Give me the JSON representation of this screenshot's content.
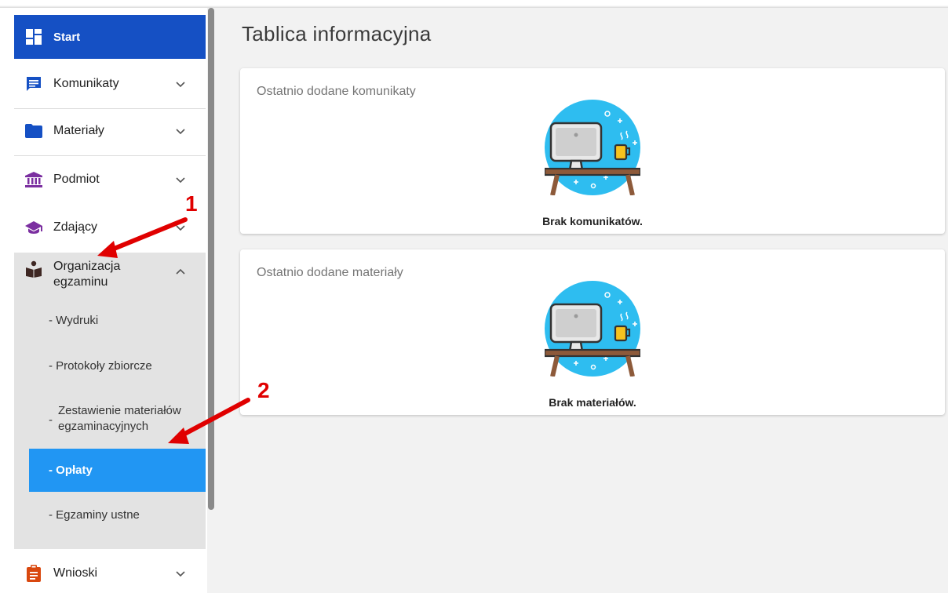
{
  "sidebar": {
    "items": [
      {
        "label": "Start",
        "icon": "dashboard-icon",
        "active": true
      },
      {
        "label": "Komunikaty",
        "icon": "message-icon"
      },
      {
        "label": "Materiały",
        "icon": "folder-icon"
      },
      {
        "label": "Podmiot",
        "icon": "institution-icon"
      },
      {
        "label": "Zdający",
        "icon": "graduation-cap-icon"
      },
      {
        "label_line1": "Organizacja",
        "label_line2": "egzaminu",
        "icon": "exam-organization-icon",
        "expanded": true
      },
      {
        "label": "Wnioski",
        "icon": "clipboard-icon"
      }
    ],
    "subitems": [
      {
        "label": "- Wydruki"
      },
      {
        "label": "- Protokoły zbiorcze"
      },
      {
        "prefix": "-",
        "label_line1": "Zestawienie materiałów",
        "label_line2": "egzaminacyjnych"
      },
      {
        "label": "- Opłaty",
        "active": true
      },
      {
        "label": "- Egzaminy ustne"
      }
    ]
  },
  "main": {
    "title": "Tablica informacyjna",
    "cards": [
      {
        "title": "Ostatnio dodane komunikaty",
        "empty_text": "Brak komunikatów."
      },
      {
        "title": "Ostatnio dodane materiały",
        "empty_text": "Brak materiałów."
      }
    ]
  },
  "annotations": {
    "marker1": "1",
    "marker2": "2"
  },
  "colors": {
    "start_bg": "#1550c4",
    "active_sub_bg": "#2196f3",
    "annotation": "#e00000",
    "icon_blue": "#1550c4",
    "icon_purple": "#7b2fa0",
    "icon_brown": "#3e2723",
    "icon_orange": "#d9480f"
  }
}
